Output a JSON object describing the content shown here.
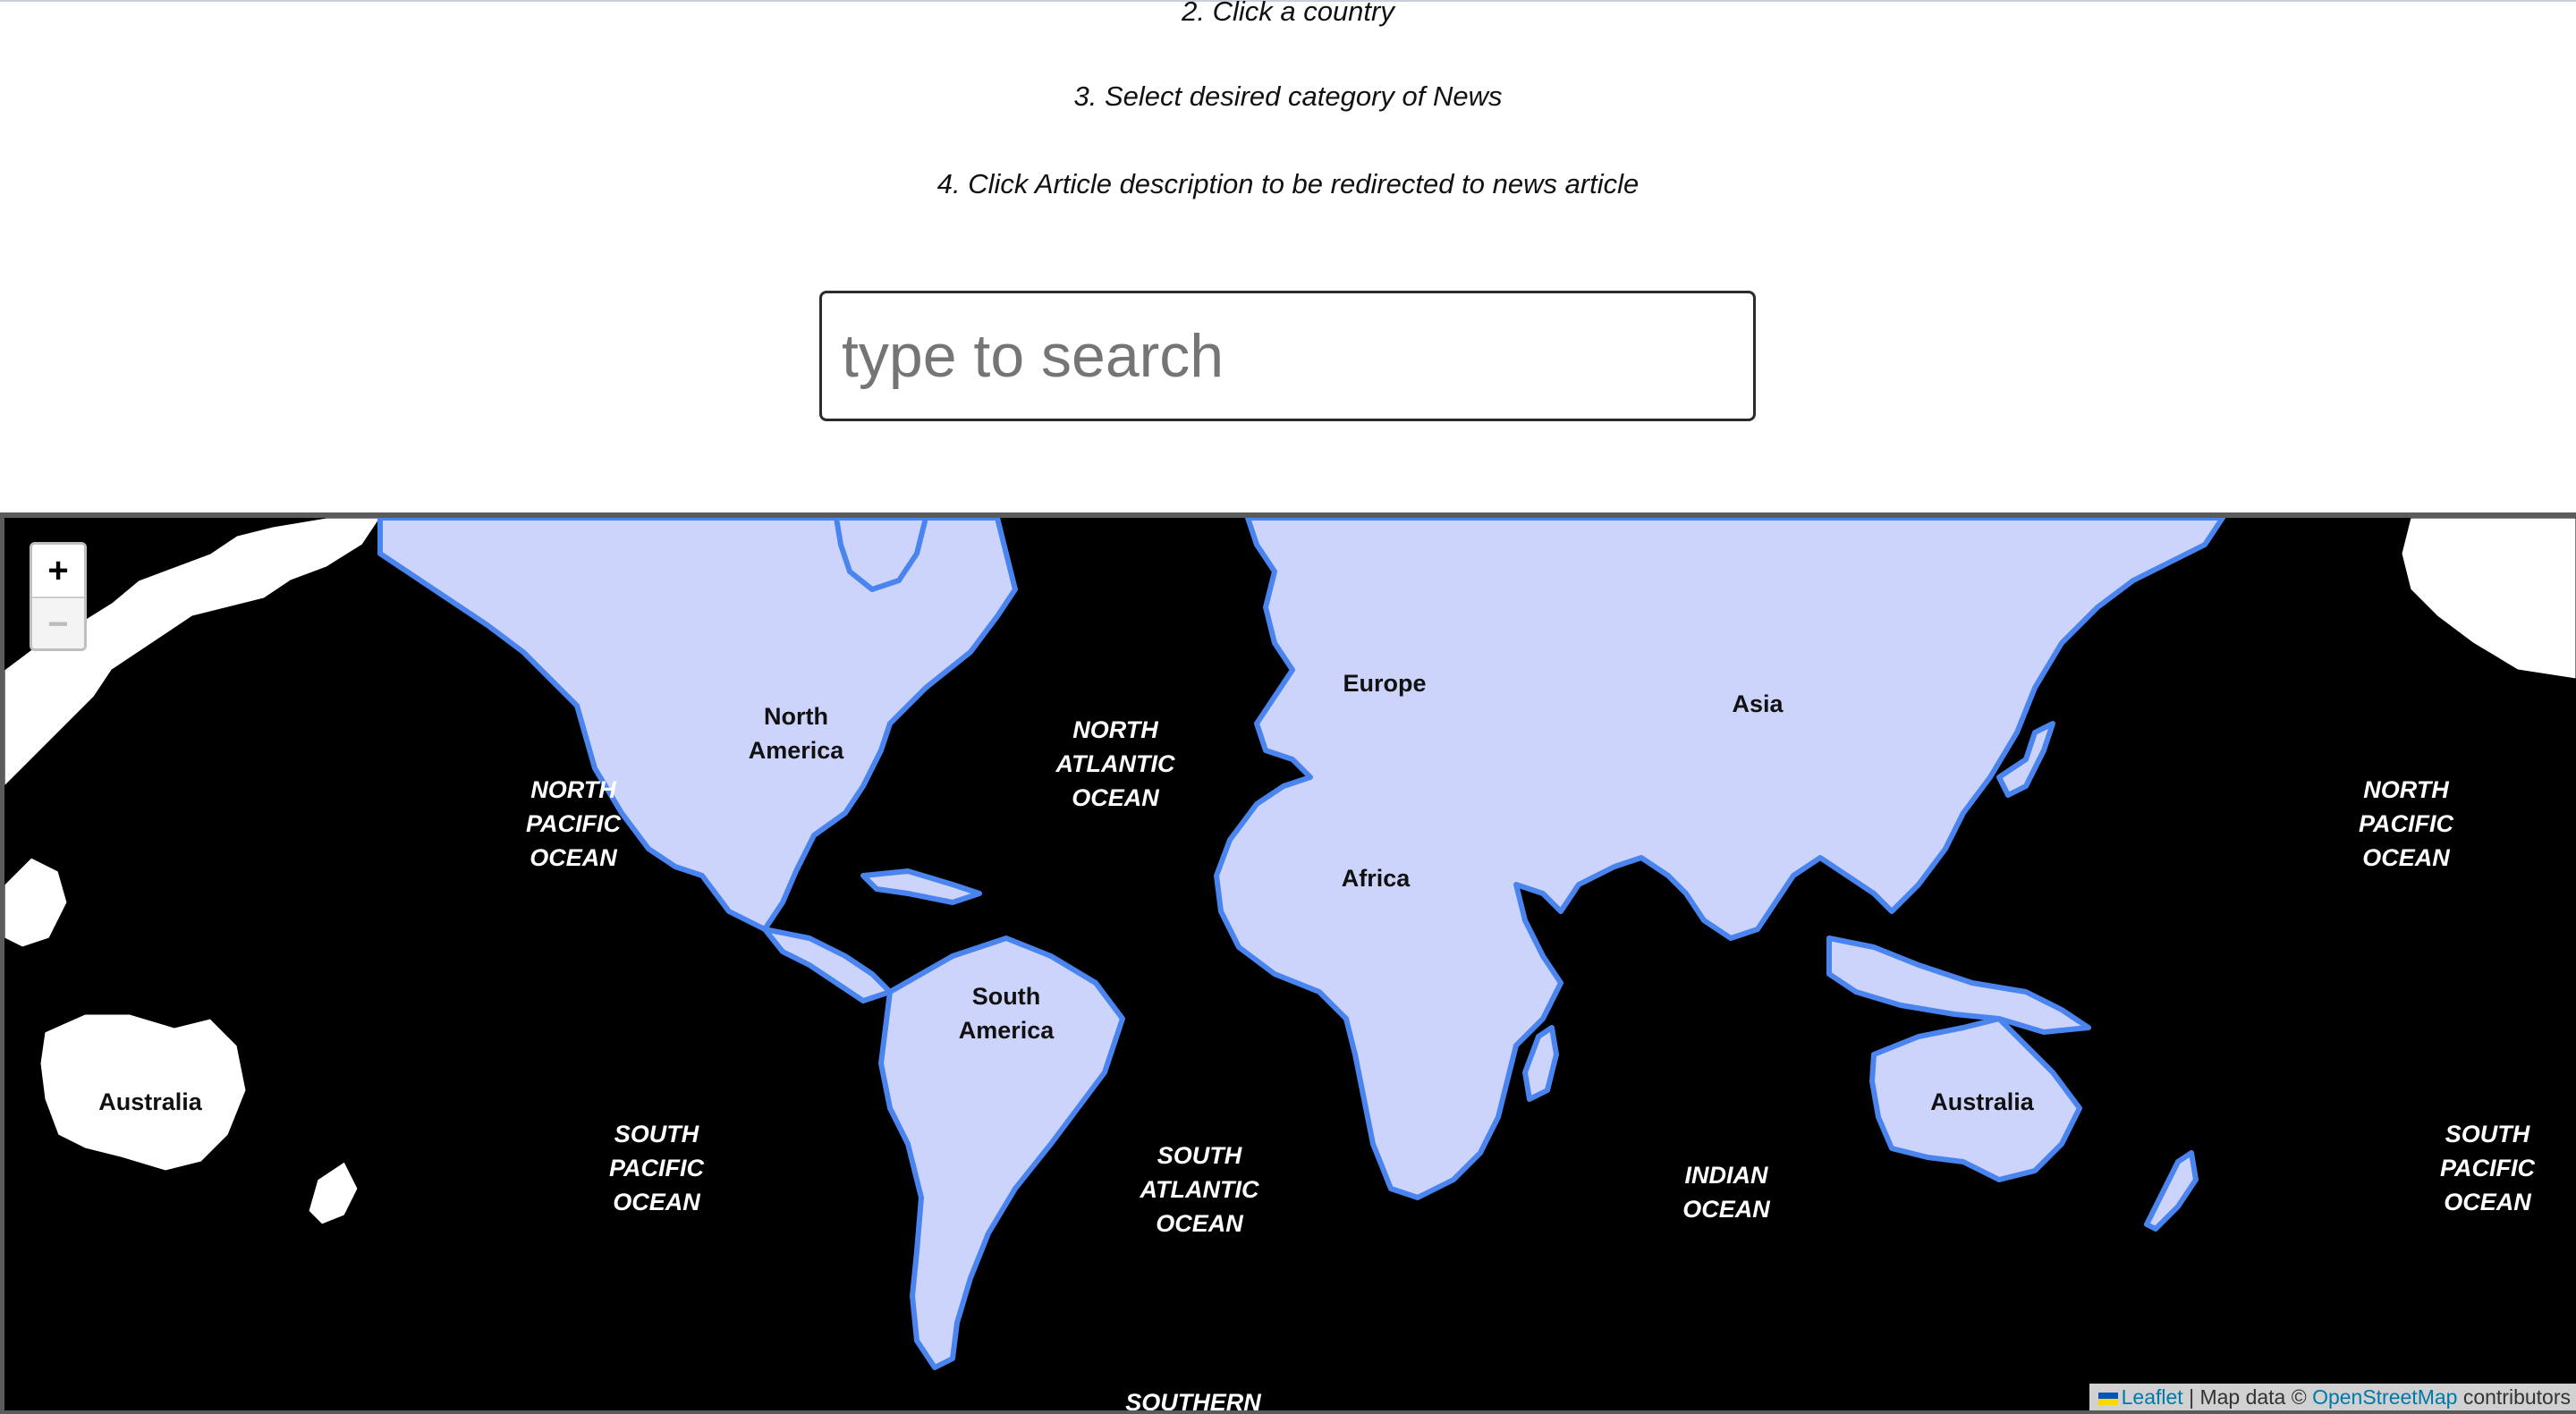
{
  "instructions": [
    "2. Click a country",
    "3. Select desired category of News",
    "4. Click Article description to be redirected to news article"
  ],
  "search": {
    "placeholder": "type to search",
    "value": ""
  },
  "map": {
    "zoom_in": "+",
    "zoom_out": "−",
    "ocean_labels": {
      "north_pacific_west": "NORTH\nPACIFIC\nOCEAN",
      "north_atlantic": "NORTH\nATLANTIC\nOCEAN",
      "north_pacific_east": "NORTH\nPACIFIC\nOCEAN",
      "south_pacific_west": "SOUTH\nPACIFIC\nOCEAN",
      "south_atlantic": "SOUTH\nATLANTIC\nOCEAN",
      "indian": "INDIAN\nOCEAN",
      "south_pacific_east": "SOUTH\nPACIFIC\nOCEAN",
      "southern": "SOUTHERN"
    },
    "continent_labels": {
      "north_america": "North\nAmerica",
      "europe": "Europe",
      "asia": "Asia",
      "africa": "Africa",
      "south_america": "South\nAmerica",
      "australia_west": "Australia",
      "australia_east": "Australia"
    },
    "colors": {
      "ocean": "#000000",
      "land_fill": "#cdd4fb",
      "border": "#4a84ee",
      "unhighlighted_land": "#ffffff"
    },
    "attribution": {
      "leaflet": "Leaflet",
      "separator": "|",
      "map_data": "Map data ©",
      "osm": "OpenStreetMap",
      "contributors": "contributors"
    }
  }
}
